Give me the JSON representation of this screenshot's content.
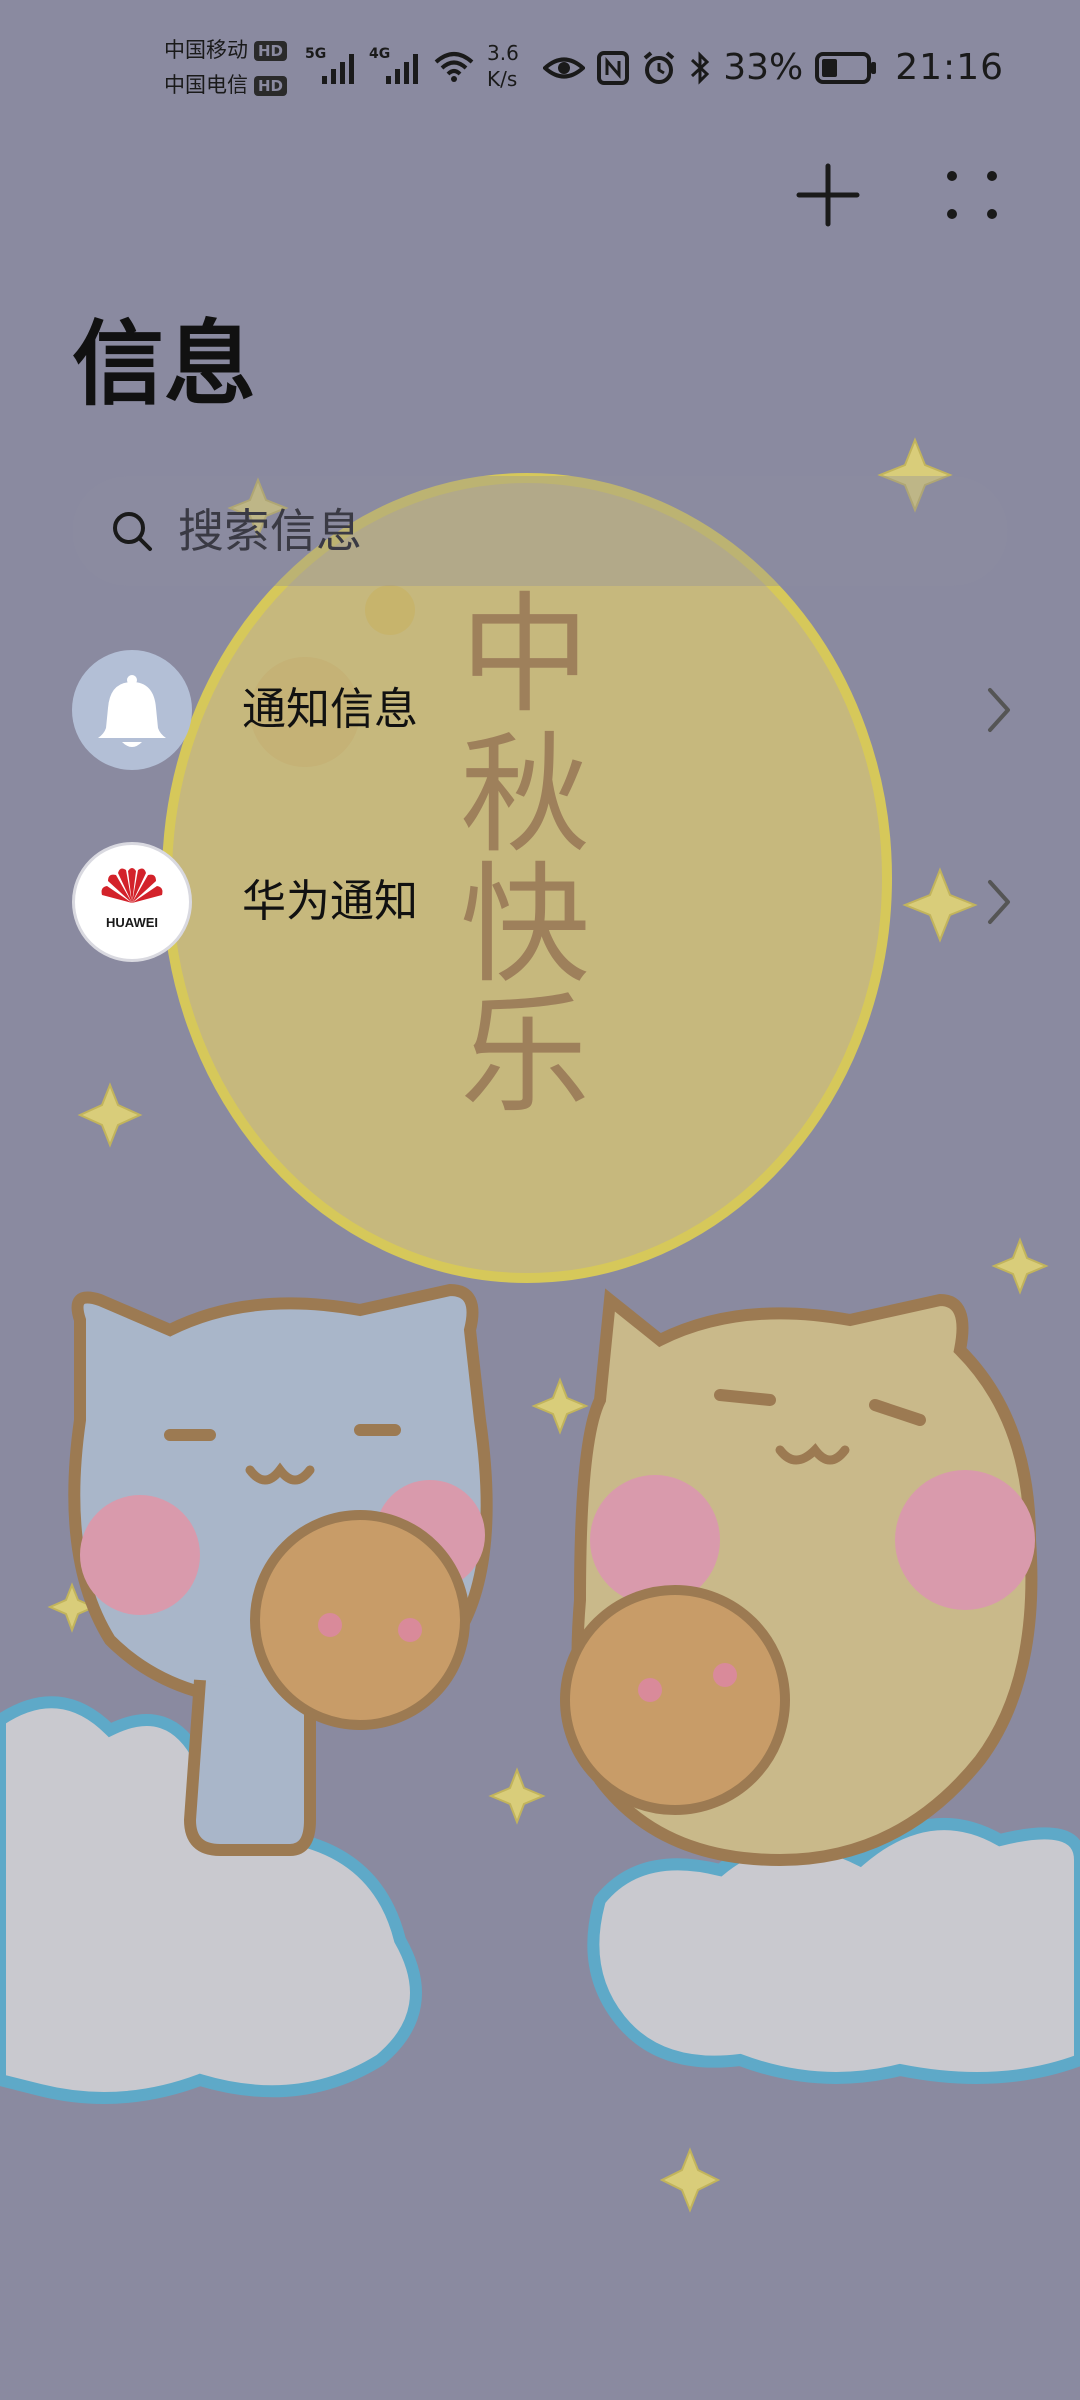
{
  "status_bar": {
    "carrier1": "中国移动",
    "carrier2": "中国电信",
    "hd_badge": "HD",
    "net1": "5G",
    "net2": "4G",
    "speed_value": "3.6",
    "speed_unit": "K/s",
    "battery_percent": "33%",
    "time": "21:16"
  },
  "toolbar": {
    "add_icon": "plus-icon",
    "more_icon": "more-dots-icon"
  },
  "page": {
    "title": "信息"
  },
  "search": {
    "placeholder": "搜索信息"
  },
  "conversations": [
    {
      "label": "通知信息",
      "icon": "bell-icon"
    },
    {
      "label": "华为通知",
      "icon": "huawei-logo",
      "logo_text": "HUAWEI"
    }
  ],
  "wallpaper": {
    "moon_text": [
      "中",
      "秋",
      "快",
      "乐"
    ]
  },
  "colors": {
    "background": "#8a8aa0",
    "moon": "#c8b97a",
    "huawei_red": "#d3222a"
  }
}
